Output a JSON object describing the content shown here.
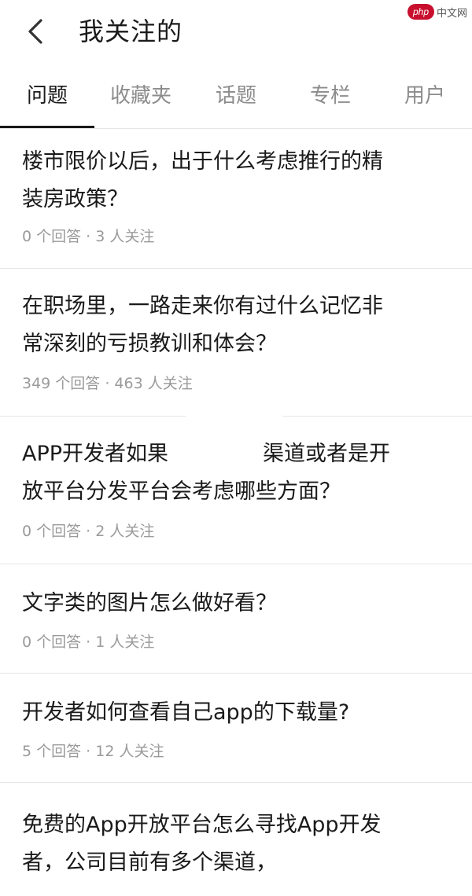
{
  "header": {
    "title": "我关注的",
    "watermark_logo": "php",
    "watermark_text": "中文网",
    "back_icon": "chevron-left-icon"
  },
  "tabs": [
    {
      "label": "问题",
      "active": true
    },
    {
      "label": "收藏夹",
      "active": false
    },
    {
      "label": "话题",
      "active": false
    },
    {
      "label": "专栏",
      "active": false
    },
    {
      "label": "用户",
      "active": false
    }
  ],
  "items": [
    {
      "title_line1": "楼市限价以后，出于什么考虑推行的精",
      "title_line2": "装房政策？",
      "meta": "0 个回答 · 3 人关注"
    },
    {
      "title_line1": "在职场里，一路走来你有过什么记忆非",
      "title_line2": "常深刻的亏损教训和体会？",
      "meta": "349 个回答 · 463 人关注"
    },
    {
      "title_line1_a": "APP开发者如果",
      "title_line1_b": "渠道或者是开",
      "title_line2": "放平台分发平台会考虑哪些方面？",
      "meta": "0 个回答 · 2 人关注"
    },
    {
      "title_line1": "文字类的图片怎么做好看？",
      "meta": "0 个回答 · 1 人关注"
    },
    {
      "title_line1": "开发者如何查看自己app的下载量?",
      "meta": "5 个回答 · 12 人关注"
    },
    {
      "title_line1": "免费的App开放平台怎么寻找App开发",
      "title_line2": "者，公司目前有多个渠道，"
    }
  ]
}
